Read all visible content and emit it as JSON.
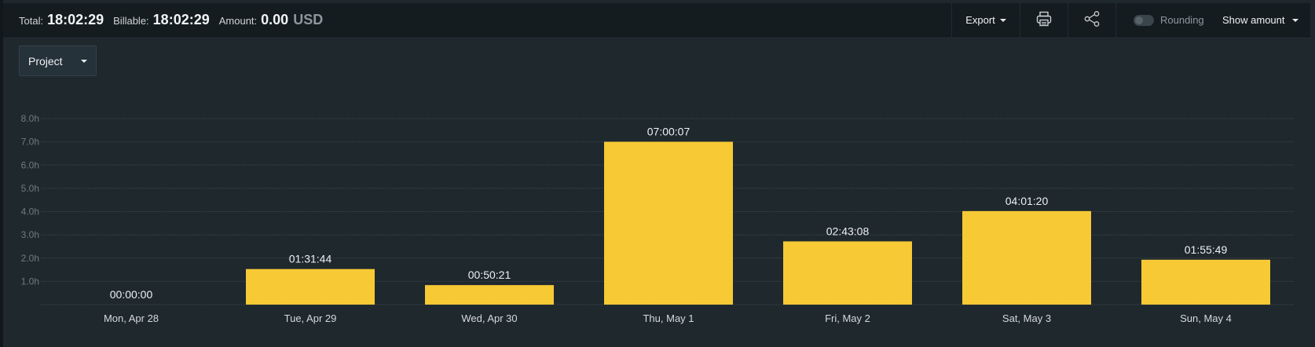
{
  "summary": {
    "total_label": "Total:",
    "total_value": "18:02:29",
    "billable_label": "Billable:",
    "billable_value": "18:02:29",
    "amount_label": "Amount:",
    "amount_value": "0.00",
    "currency": "USD"
  },
  "toolbar": {
    "export_label": "Export",
    "print_icon": "print-icon",
    "share_icon": "share-icon",
    "rounding_label": "Rounding",
    "rounding_enabled": false,
    "show_amount_label": "Show amount"
  },
  "groupby": {
    "selected": "Project"
  },
  "colors": {
    "bar": "#f6c935",
    "background": "#1f282d",
    "topbar": "#151c20",
    "grid": "#3a474e"
  },
  "chart_data": {
    "type": "bar",
    "categories": [
      "Mon, Apr 28",
      "Tue, Apr 29",
      "Wed, Apr 30",
      "Thu, May 1",
      "Fri, May 2",
      "Sat, May 3",
      "Sun, May 4"
    ],
    "values": [
      0.0,
      1.529,
      0.839,
      7.002,
      2.719,
      4.022,
      1.93
    ],
    "data_labels": [
      "00:00:00",
      "01:31:44",
      "00:50:21",
      "07:00:07",
      "02:43:08",
      "04:01:20",
      "01:55:49"
    ],
    "y_ticks": [
      "1.0h",
      "2.0h",
      "3.0h",
      "4.0h",
      "5.0h",
      "6.0h",
      "7.0h",
      "8.0h"
    ],
    "ylim": [
      0,
      8
    ],
    "grid": true,
    "xlabel": "",
    "ylabel": ""
  }
}
